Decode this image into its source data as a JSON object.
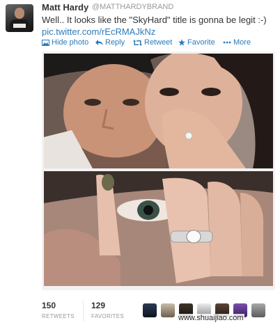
{
  "tweet": {
    "author_name": "Matt Hardy",
    "author_handle": "@MATTHARDYBRAND",
    "text": "Well.. It looks like the \"SkyHard\" title is gonna be legit :-)",
    "link": "pic.twitter.com/rEcRMAJkNz"
  },
  "actions": {
    "hide_photo": "Hide photo",
    "reply": "Reply",
    "retweet": "Retweet",
    "favorite": "Favorite",
    "more": "More"
  },
  "stats": {
    "retweets_count": "150",
    "retweets_label": "RETWEETS",
    "favorites_count": "129",
    "favorites_label": "FAVORITES"
  },
  "watermark": "www.shuaijiao.com",
  "colors": {
    "link": "#2b7bb9",
    "muted": "#999999",
    "text": "#333333"
  }
}
